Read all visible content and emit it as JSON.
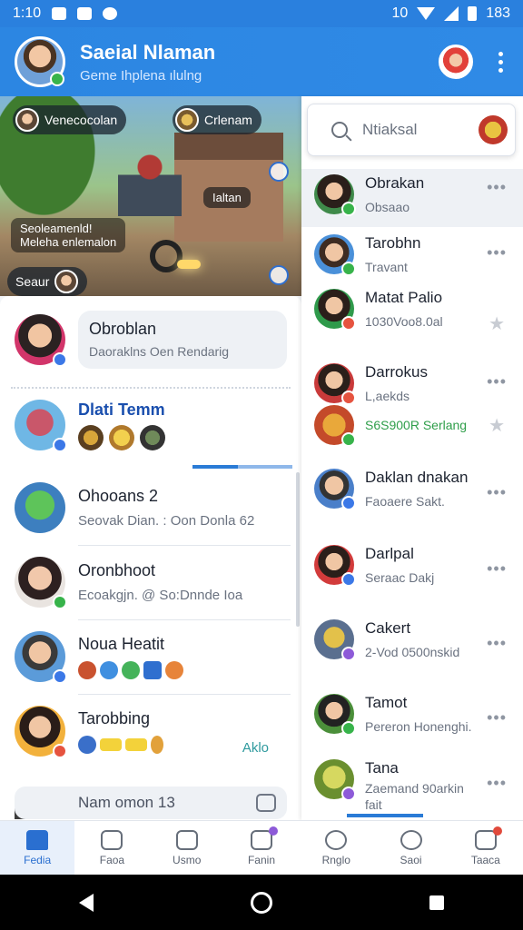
{
  "status": {
    "time": "1:10",
    "battery": "183",
    "network": "10"
  },
  "app": {
    "title": "Saeial Nlaman",
    "subtitle": "Geme Ihplena ılulng"
  },
  "banner": {
    "chip_left": "Venecocolan",
    "chip_right": "Crlenam",
    "pill_label": "Ialtan",
    "side_line1": "Seoleamenld!",
    "side_line2": "Meleha enlemalon",
    "bottom_chip": "Seaur"
  },
  "compose": {
    "name": "Obroblan",
    "text": "Daoraklns Oen Rendarig"
  },
  "featured": {
    "name": "Dlati Temm"
  },
  "progress_left": 0.45,
  "left_list": [
    {
      "name": "Ohooans 2",
      "sub": "Seovak Dian. : Oon Donla 62"
    },
    {
      "name": "Oronbhoot",
      "sub": "Ecoakgjn. @ So:Dnnde Ioa"
    },
    {
      "name": "Noua Heatit",
      "sub": ""
    },
    {
      "name": "Tarobbing",
      "sub": "",
      "extra": "Aklo"
    }
  ],
  "last_row": {
    "text": "Nam omon 13"
  },
  "search": {
    "placeholder": "Ntiaksal"
  },
  "right_list": [
    {
      "name": "Obrakan",
      "sub": "Obsaao"
    },
    {
      "name": "Tarobhn",
      "sub": "Travant"
    },
    {
      "name": "Matat Palio",
      "sub": "1030Voo8.0al"
    },
    {
      "name": "Darrokus",
      "sub": "L,aekds"
    },
    {
      "name": "",
      "sub": "S6S900R Serlang"
    },
    {
      "name": "Daklan dnakan",
      "sub": "Faoaere Sakt."
    },
    {
      "name": "Darlpal",
      "sub": "Seraac Dakj"
    },
    {
      "name": "Cakert",
      "sub": "2-Vod 0500nskid"
    },
    {
      "name": "Tamot",
      "sub": "Pereron Honenghi."
    },
    {
      "name": "Tana",
      "sub": "Zaemand 90arkin"
    },
    {
      "name": "",
      "sub": "fait"
    }
  ],
  "tabs": [
    "Fedia",
    "Faoa",
    "Usmo",
    "Fanin",
    "Rnglo",
    "Saoi",
    "Taaca"
  ],
  "icons": {
    "more": "more-vert-icon",
    "search": "search-icon",
    "star": "star-icon",
    "camera": "camera-icon"
  },
  "colors": {
    "primary": "#2a80de",
    "accent_green": "#37b34a",
    "accent_red": "#e6533f"
  }
}
